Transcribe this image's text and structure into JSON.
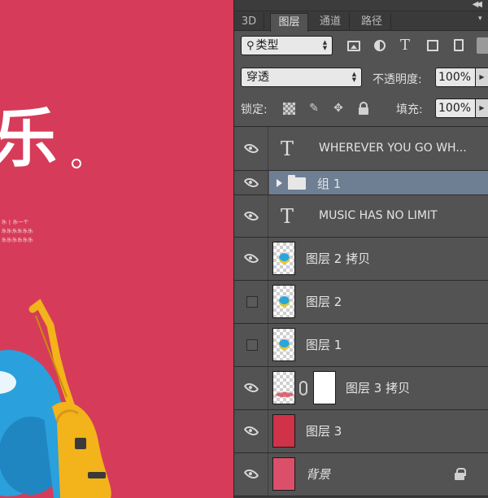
{
  "canvas": {
    "headline_char": "乐",
    "tiny_lines": [
      "乐 | 乐一个",
      "乐乐乐乐乐乐",
      "乐乐乐乐乐乐"
    ],
    "colors": {
      "background": "#d63c59",
      "guitar": "#f2b31b",
      "character_blue": "#2aa0dc"
    }
  },
  "tabs": [
    {
      "label": "3D",
      "active": false
    },
    {
      "label": "图层",
      "active": true
    },
    {
      "label": "通道",
      "active": false
    },
    {
      "label": "路径",
      "active": false
    }
  ],
  "toolbar": {
    "filter_select_value": "类型",
    "filter_icons": [
      "pixel-layer-filter-icon",
      "adjustment-layer-filter-icon",
      "type-layer-filter-icon",
      "shape-layer-filter-icon",
      "smart-object-filter-icon"
    ],
    "type_filter_glyph": "T"
  },
  "blend": {
    "mode": "穿透",
    "opacity_label": "不透明度:",
    "opacity_value": "100%"
  },
  "lock": {
    "label": "锁定:",
    "fill_label": "填充:",
    "fill_value": "100%"
  },
  "layers": [
    {
      "name": "WHEREVER YOU GO WH...",
      "kind": "type",
      "visible": true,
      "type_glyph": "T"
    },
    {
      "name": "组 1",
      "kind": "group",
      "visible": true,
      "selected": true
    },
    {
      "name": "MUSIC HAS NO LIMIT",
      "kind": "type",
      "visible": true,
      "type_glyph": "T"
    },
    {
      "name": "图层 2 拷贝",
      "kind": "pixel",
      "visible": true
    },
    {
      "name": "图层 2",
      "kind": "pixel",
      "visible": false
    },
    {
      "name": "图层 1",
      "kind": "pixel",
      "visible": false
    },
    {
      "name": "图层 3 拷贝",
      "kind": "masked",
      "visible": true
    },
    {
      "name": "图层 3",
      "kind": "solid",
      "visible": true
    },
    {
      "name": "背景",
      "kind": "background",
      "visible": true,
      "locked": true
    }
  ],
  "colors": {
    "panel_bg": "#535353",
    "selected_row": "#6e7f94",
    "tab_bar": "#3a3a3a"
  }
}
